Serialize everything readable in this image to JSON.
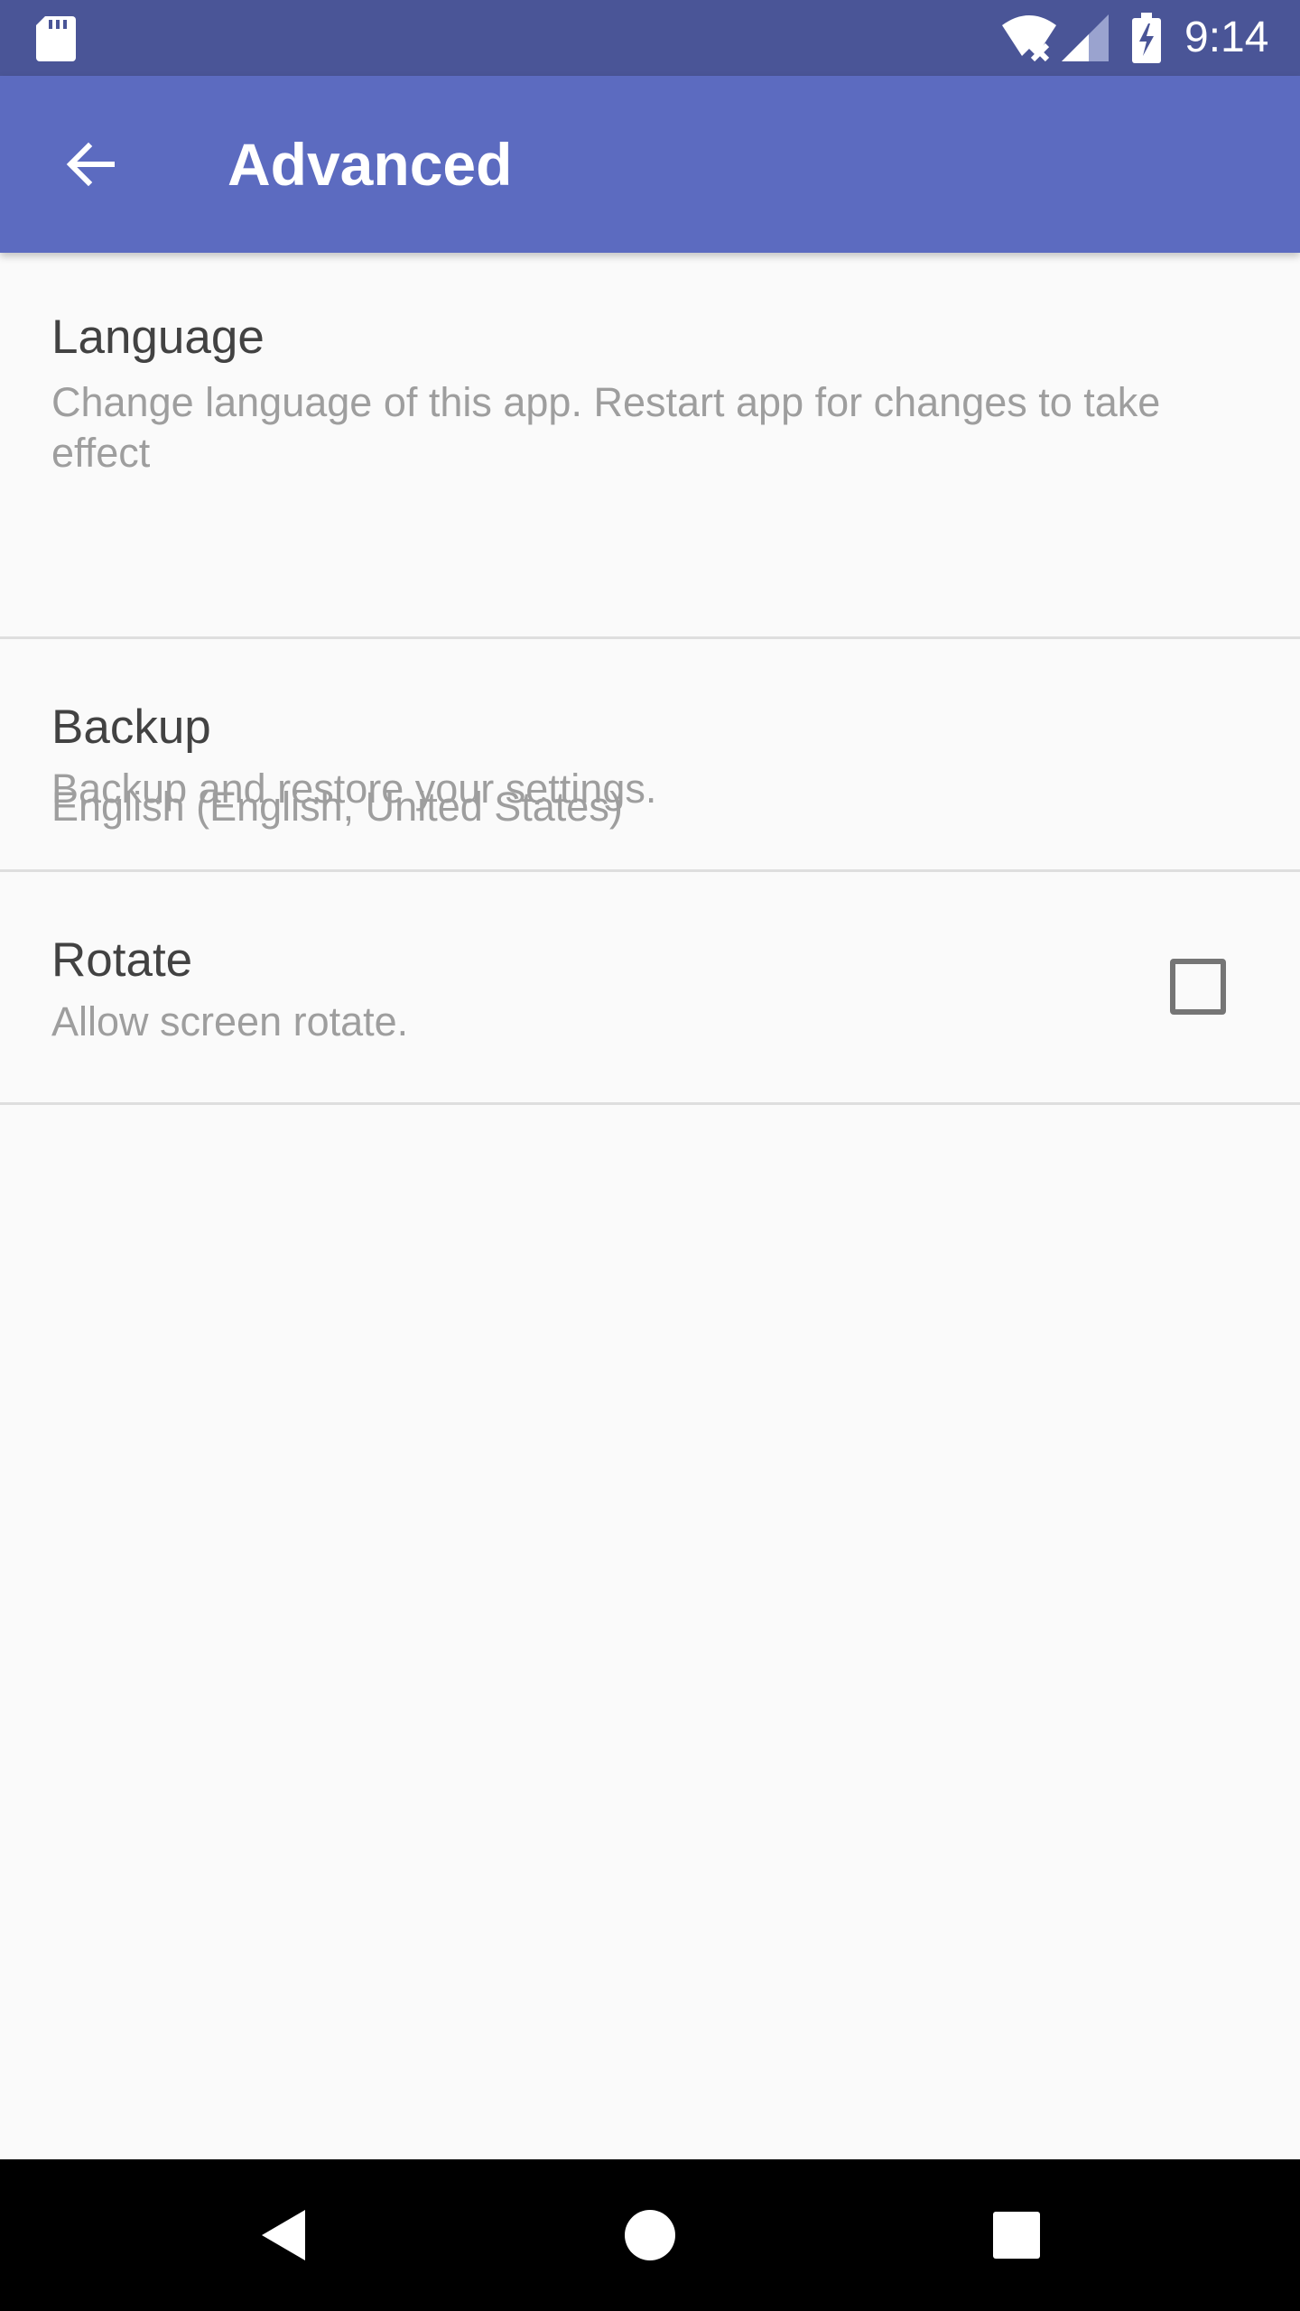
{
  "status_bar": {
    "time": "9:14",
    "icons": [
      "sd-card-icon",
      "wifi-icon",
      "cell-signal-icon",
      "battery-charging-icon"
    ]
  },
  "app_bar": {
    "title": "Advanced",
    "back_icon": "arrow-back-icon"
  },
  "preferences": {
    "language": {
      "title": "Language",
      "summary": "Change language of this app. Restart app for changes to take effect",
      "value": "English (English, United States)"
    },
    "backup": {
      "title": "Backup",
      "summary": "Backup and restore your settings."
    },
    "rotate": {
      "title": "Rotate",
      "summary": "Allow screen rotate.",
      "checked": false
    }
  },
  "nav_bar": {
    "buttons": [
      "nav-back-icon",
      "nav-home-icon",
      "nav-recents-icon"
    ]
  },
  "colors": {
    "status_bar": "#4a5597",
    "app_bar": "#5c6bc0",
    "background": "#fafafa",
    "title_text": "#424242",
    "summary_text": "#9e9e9e"
  }
}
